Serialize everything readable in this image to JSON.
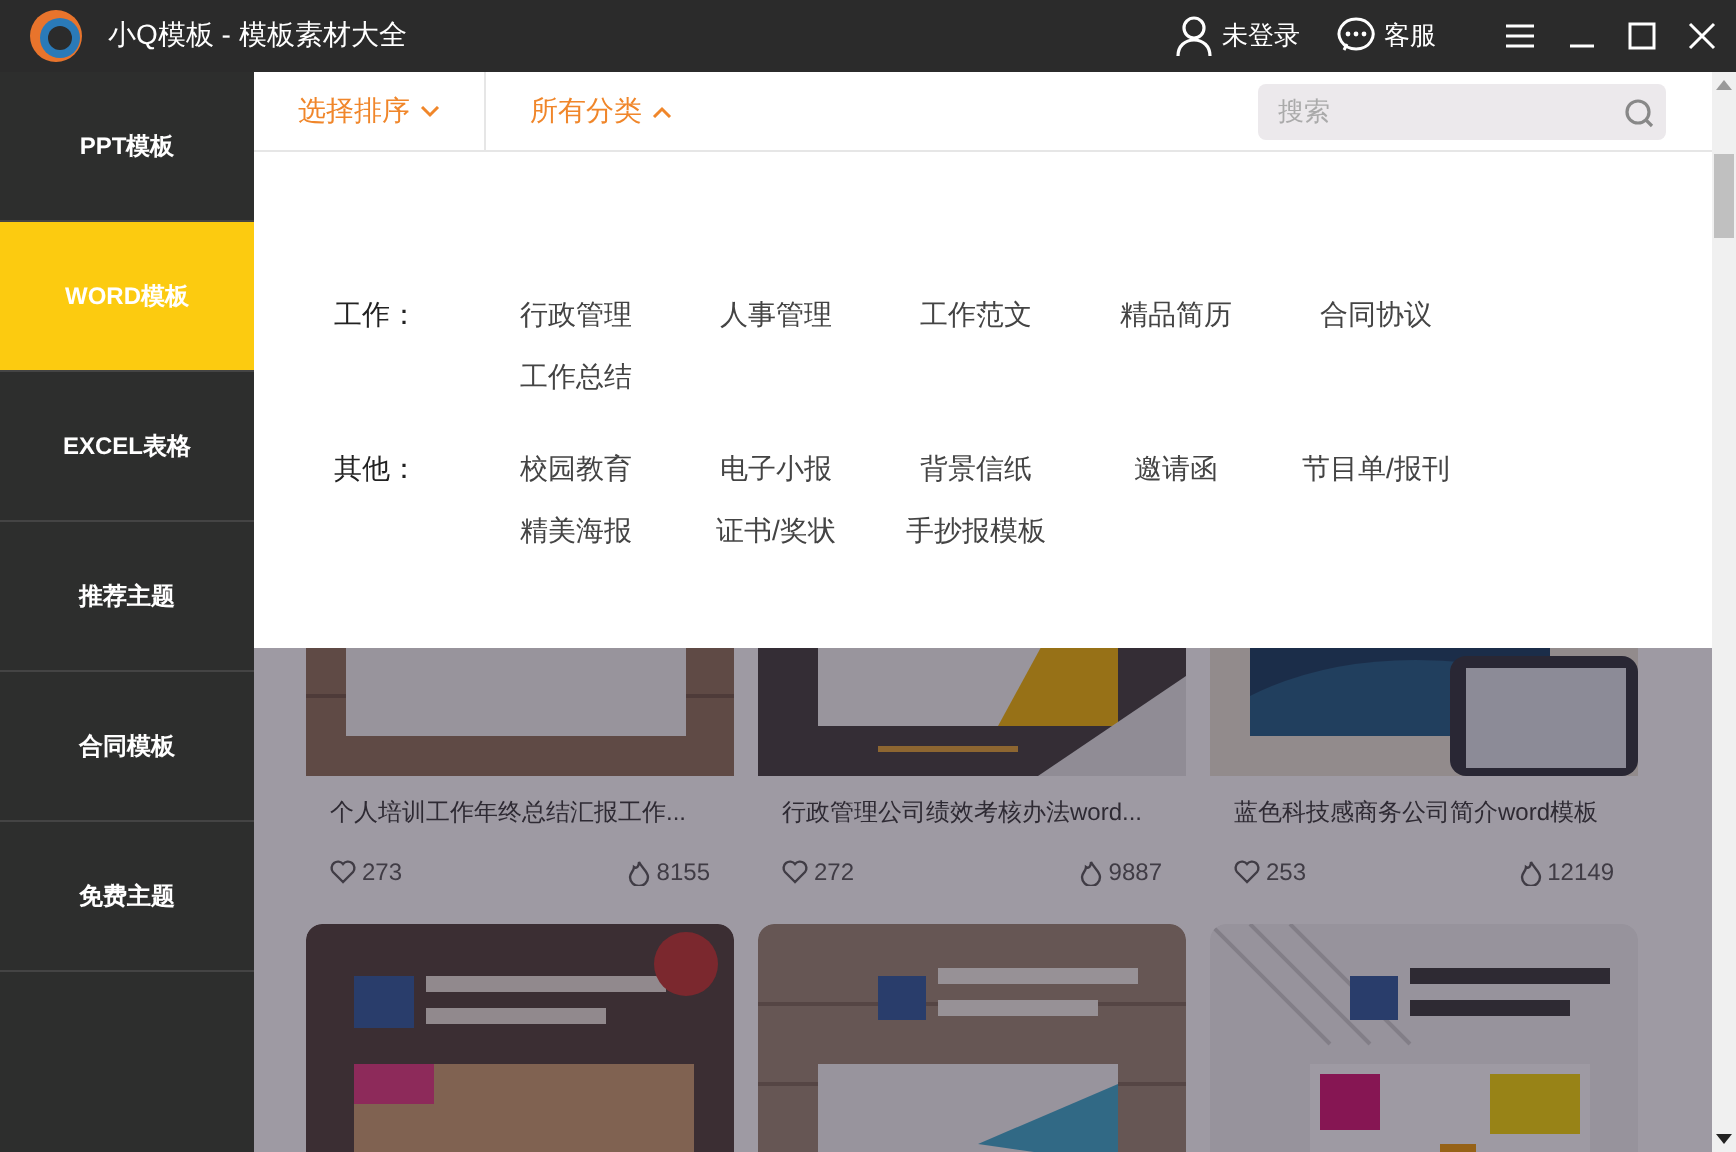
{
  "window": {
    "title": "小Q模板 - 模板素材大全",
    "login": "未登录",
    "service": "客服"
  },
  "sidebar": {
    "items": [
      {
        "label": "PPT模板",
        "selected": false
      },
      {
        "label": "WORD模板",
        "selected": true
      },
      {
        "label": "EXCEL表格",
        "selected": false
      },
      {
        "label": "推荐主题",
        "selected": false
      },
      {
        "label": "合同模板",
        "selected": false
      },
      {
        "label": "免费主题",
        "selected": false
      }
    ]
  },
  "filters": [
    {
      "label": "选择排序",
      "expanded": false
    },
    {
      "label": "所有分类",
      "expanded": true
    }
  ],
  "search": {
    "placeholder": "搜索"
  },
  "categories": [
    {
      "label": "工作：",
      "items": [
        "行政管理",
        "人事管理",
        "工作范文",
        "精品简历",
        "合同协议",
        "工作总结"
      ]
    },
    {
      "label": "其他：",
      "items": [
        "校园教育",
        "电子小报",
        "背景信纸",
        "邀请函",
        "节目单/报刊",
        "精美海报",
        "证书/奖状",
        "手抄报模板"
      ]
    }
  ],
  "cards": [
    {
      "kind": "picture",
      "title": "个人培训工作年终总结汇报工作...",
      "likes": "273",
      "views": "8155"
    },
    {
      "kind": "picture",
      "title": "行政管理公司绩效考核办法word...",
      "likes": "272",
      "views": "9887"
    },
    {
      "kind": "picture",
      "title": "蓝色科技感商务公司简介word模板",
      "likes": "253",
      "views": "12149"
    },
    {
      "kind": "picture"
    },
    {
      "kind": "picture"
    },
    {
      "kind": "picture"
    }
  ]
}
